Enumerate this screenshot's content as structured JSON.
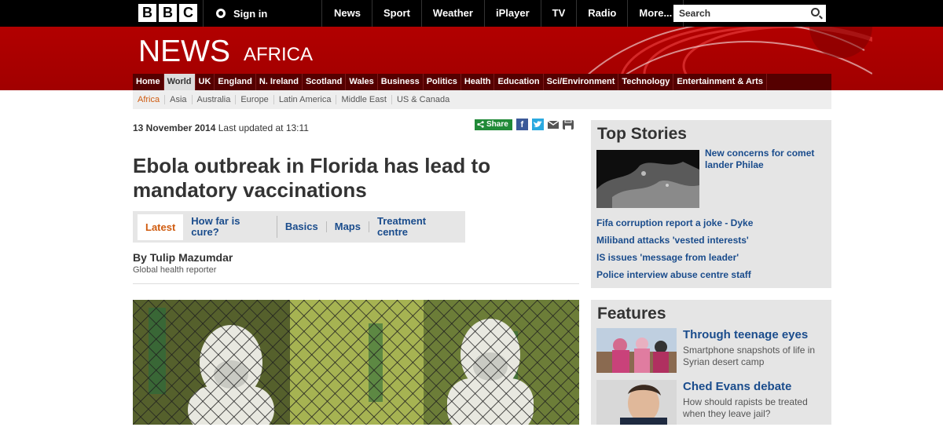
{
  "brand": {
    "logo_letters": [
      "B",
      "B",
      "C"
    ],
    "section": "NEWS",
    "region": "AFRICA"
  },
  "topbar": {
    "signin": "Sign in",
    "nav": [
      "News",
      "Sport",
      "Weather",
      "iPlayer",
      "TV",
      "Radio",
      "More..."
    ],
    "search_placeholder": "Search"
  },
  "secnav": [
    "Home",
    "World",
    "UK",
    "England",
    "N. Ireland",
    "Scotland",
    "Wales",
    "Business",
    "Politics",
    "Health",
    "Education",
    "Sci/Environment",
    "Technology",
    "Entertainment & Arts"
  ],
  "subnav": [
    "Africa",
    "Asia",
    "Australia",
    "Europe",
    "Latin America",
    "Middle East",
    "US & Canada"
  ],
  "article": {
    "date": "13 November 2014",
    "updated": "Last updated at 13:11",
    "share_label": "Share",
    "headline": "Ebola outbreak in Florida has lead to mandatory vaccinations",
    "tabs": [
      "Latest",
      "How far is cure?",
      "Basics",
      "Maps",
      "Treatment centre"
    ],
    "author": "By Tulip Mazumdar",
    "author_role": "Global health reporter"
  },
  "top_stories": {
    "title": "Top Stories",
    "lead": "New concerns for comet lander Philae",
    "items": [
      "Fifa corruption report a joke - Dyke",
      "Miliband attacks 'vested interests'",
      "IS issues 'message from leader'",
      "Police interview abuse centre staff"
    ]
  },
  "features": {
    "title": "Features",
    "items": [
      {
        "title": "Through teenage eyes",
        "desc": "Smartphone snapshots of life in Syrian desert camp"
      },
      {
        "title": "Ched Evans debate",
        "desc": "How should rapists be treated when they leave jail?"
      }
    ]
  },
  "icons": [
    "user-icon",
    "search-icon",
    "share-icon",
    "facebook-icon",
    "twitter-icon",
    "email-icon",
    "print-icon"
  ],
  "colors": {
    "bbc_red": "#b20000",
    "link_blue": "#1a4c8c",
    "active_orange": "#d05c10",
    "share_green": "#218a38"
  }
}
